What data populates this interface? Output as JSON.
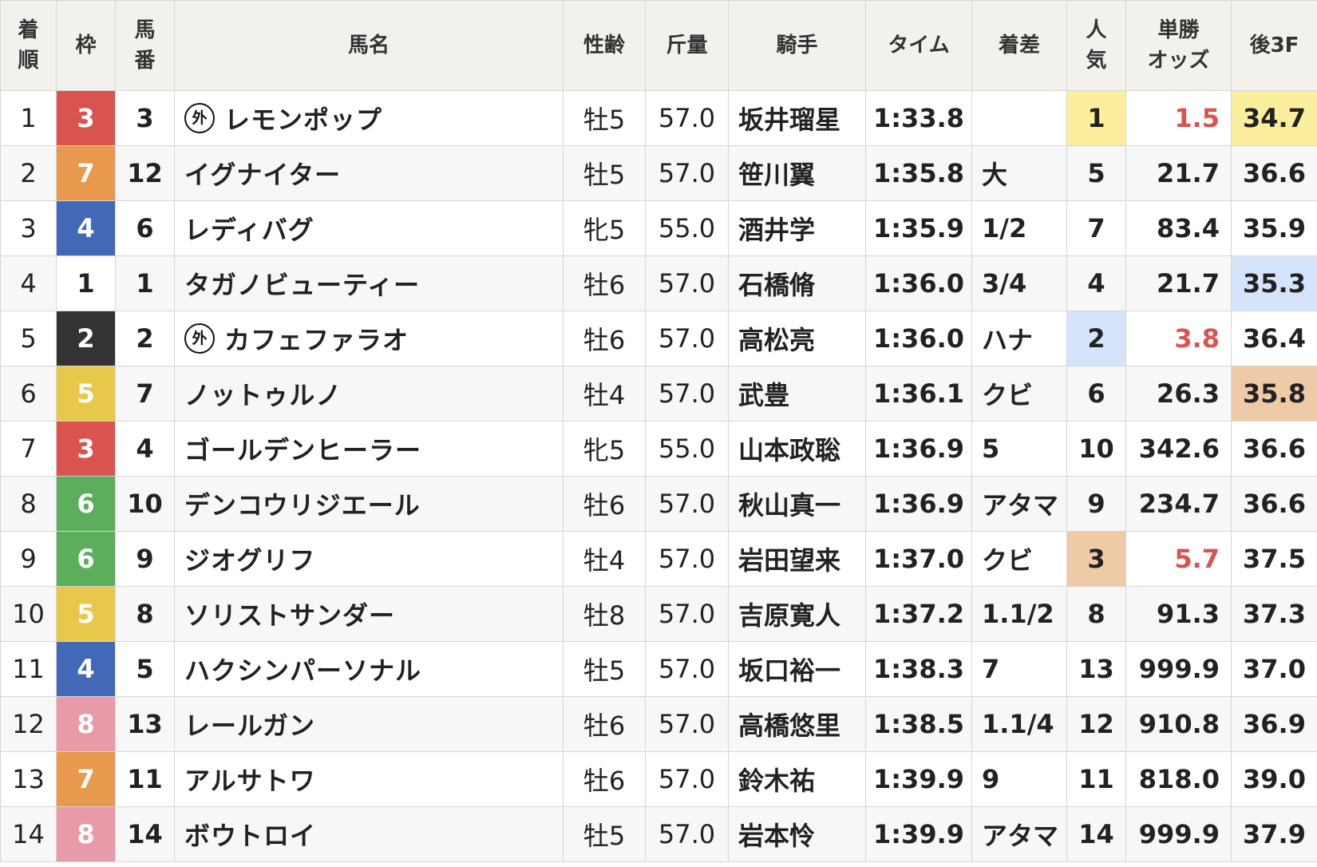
{
  "colors": {
    "waku": {
      "1": {
        "bg": "#ffffff",
        "fg": "#222222"
      },
      "2": {
        "bg": "#333333",
        "fg": "#ffffff"
      },
      "3": {
        "bg": "#d9534f",
        "fg": "#ffffff"
      },
      "4": {
        "bg": "#4468b8",
        "fg": "#ffffff"
      },
      "5": {
        "bg": "#e7c84a",
        "fg": "#ffffff"
      },
      "6": {
        "bg": "#5cad5c",
        "fg": "#ffffff"
      },
      "7": {
        "bg": "#e8994e",
        "fg": "#ffffff"
      },
      "8": {
        "bg": "#e89aa8",
        "fg": "#ffffff"
      }
    },
    "pop_highlight": {
      "1": "#fbee9c",
      "2": "#d6e4fb",
      "3": "#efcaa6"
    },
    "last3f_highlight": {
      "1": "#fbee9c",
      "2": "#d6e4fb",
      "3": "#efcaa6"
    },
    "odds_low": "#d9534f"
  },
  "headers": [
    {
      "key": "rank",
      "label": "着\n順"
    },
    {
      "key": "waku",
      "label": "枠"
    },
    {
      "key": "num",
      "label": "馬\n番"
    },
    {
      "key": "horse",
      "label": "馬名"
    },
    {
      "key": "sexage",
      "label": "性齢"
    },
    {
      "key": "weight",
      "label": "斤量"
    },
    {
      "key": "jockey",
      "label": "騎手"
    },
    {
      "key": "time",
      "label": "タイム"
    },
    {
      "key": "margin",
      "label": "着差"
    },
    {
      "key": "pop",
      "label": "人\n気"
    },
    {
      "key": "odds",
      "label": "単勝\nオッズ"
    },
    {
      "key": "last3f",
      "label": "後3F"
    }
  ],
  "foreign_mark": "外",
  "rows": [
    {
      "rank": "1",
      "waku": "3",
      "num": "3",
      "foreign": true,
      "horse": "レモンポップ",
      "sexage": "牡5",
      "weight": "57.0",
      "jockey": "坂井瑠星",
      "time": "1:33.8",
      "margin": "",
      "pop": "1",
      "pop_hl": "1",
      "odds": "1.5",
      "odds_low": true,
      "last3f": "34.7",
      "last3f_hl": "1"
    },
    {
      "rank": "2",
      "waku": "7",
      "num": "12",
      "foreign": false,
      "horse": "イグナイター",
      "sexage": "牡5",
      "weight": "57.0",
      "jockey": "笹川翼",
      "time": "1:35.8",
      "margin": "大",
      "pop": "5",
      "pop_hl": "",
      "odds": "21.7",
      "odds_low": false,
      "last3f": "36.6",
      "last3f_hl": ""
    },
    {
      "rank": "3",
      "waku": "4",
      "num": "6",
      "foreign": false,
      "horse": "レディバグ",
      "sexage": "牝5",
      "weight": "55.0",
      "jockey": "酒井学",
      "time": "1:35.9",
      "margin": "1/2",
      "pop": "7",
      "pop_hl": "",
      "odds": "83.4",
      "odds_low": false,
      "last3f": "35.9",
      "last3f_hl": ""
    },
    {
      "rank": "4",
      "waku": "1",
      "num": "1",
      "foreign": false,
      "horse": "タガノビューティー",
      "sexage": "牡6",
      "weight": "57.0",
      "jockey": "石橋脩",
      "time": "1:36.0",
      "margin": "3/4",
      "pop": "4",
      "pop_hl": "",
      "odds": "21.7",
      "odds_low": false,
      "last3f": "35.3",
      "last3f_hl": "2"
    },
    {
      "rank": "5",
      "waku": "2",
      "num": "2",
      "foreign": true,
      "horse": "カフェファラオ",
      "sexage": "牡6",
      "weight": "57.0",
      "jockey": "高松亮",
      "time": "1:36.0",
      "margin": "ハナ",
      "pop": "2",
      "pop_hl": "2",
      "odds": "3.8",
      "odds_low": true,
      "last3f": "36.4",
      "last3f_hl": ""
    },
    {
      "rank": "6",
      "waku": "5",
      "num": "7",
      "foreign": false,
      "horse": "ノットゥルノ",
      "sexage": "牡4",
      "weight": "57.0",
      "jockey": "武豊",
      "time": "1:36.1",
      "margin": "クビ",
      "pop": "6",
      "pop_hl": "",
      "odds": "26.3",
      "odds_low": false,
      "last3f": "35.8",
      "last3f_hl": "3"
    },
    {
      "rank": "7",
      "waku": "3",
      "num": "4",
      "foreign": false,
      "horse": "ゴールデンヒーラー",
      "sexage": "牝5",
      "weight": "55.0",
      "jockey": "山本政聡",
      "time": "1:36.9",
      "margin": "5",
      "pop": "10",
      "pop_hl": "",
      "odds": "342.6",
      "odds_low": false,
      "last3f": "36.6",
      "last3f_hl": ""
    },
    {
      "rank": "8",
      "waku": "6",
      "num": "10",
      "foreign": false,
      "horse": "デンコウリジエール",
      "sexage": "牡6",
      "weight": "57.0",
      "jockey": "秋山真一",
      "time": "1:36.9",
      "margin": "アタマ",
      "pop": "9",
      "pop_hl": "",
      "odds": "234.7",
      "odds_low": false,
      "last3f": "36.6",
      "last3f_hl": ""
    },
    {
      "rank": "9",
      "waku": "6",
      "num": "9",
      "foreign": false,
      "horse": "ジオグリフ",
      "sexage": "牡4",
      "weight": "57.0",
      "jockey": "岩田望来",
      "time": "1:37.0",
      "margin": "クビ",
      "pop": "3",
      "pop_hl": "3",
      "odds": "5.7",
      "odds_low": true,
      "last3f": "37.5",
      "last3f_hl": ""
    },
    {
      "rank": "10",
      "waku": "5",
      "num": "8",
      "foreign": false,
      "horse": "ソリストサンダー",
      "sexage": "牡8",
      "weight": "57.0",
      "jockey": "吉原寛人",
      "time": "1:37.2",
      "margin": "1.1/2",
      "pop": "8",
      "pop_hl": "",
      "odds": "91.3",
      "odds_low": false,
      "last3f": "37.3",
      "last3f_hl": ""
    },
    {
      "rank": "11",
      "waku": "4",
      "num": "5",
      "foreign": false,
      "horse": "ハクシンパーソナル",
      "sexage": "牡5",
      "weight": "57.0",
      "jockey": "坂口裕一",
      "time": "1:38.3",
      "margin": "7",
      "pop": "13",
      "pop_hl": "",
      "odds": "999.9",
      "odds_low": false,
      "last3f": "37.0",
      "last3f_hl": ""
    },
    {
      "rank": "12",
      "waku": "8",
      "num": "13",
      "foreign": false,
      "horse": "レールガン",
      "sexage": "牡6",
      "weight": "57.0",
      "jockey": "高橋悠里",
      "time": "1:38.5",
      "margin": "1.1/4",
      "pop": "12",
      "pop_hl": "",
      "odds": "910.8",
      "odds_low": false,
      "last3f": "36.9",
      "last3f_hl": ""
    },
    {
      "rank": "13",
      "waku": "7",
      "num": "11",
      "foreign": false,
      "horse": "アルサトワ",
      "sexage": "牡6",
      "weight": "57.0",
      "jockey": "鈴木祐",
      "time": "1:39.9",
      "margin": "9",
      "pop": "11",
      "pop_hl": "",
      "odds": "818.0",
      "odds_low": false,
      "last3f": "39.0",
      "last3f_hl": ""
    },
    {
      "rank": "14",
      "waku": "8",
      "num": "14",
      "foreign": false,
      "horse": "ボウトロイ",
      "sexage": "牡5",
      "weight": "57.0",
      "jockey": "岩本怜",
      "time": "1:39.9",
      "margin": "アタマ",
      "pop": "14",
      "pop_hl": "",
      "odds": "999.9",
      "odds_low": false,
      "last3f": "37.9",
      "last3f_hl": ""
    }
  ]
}
